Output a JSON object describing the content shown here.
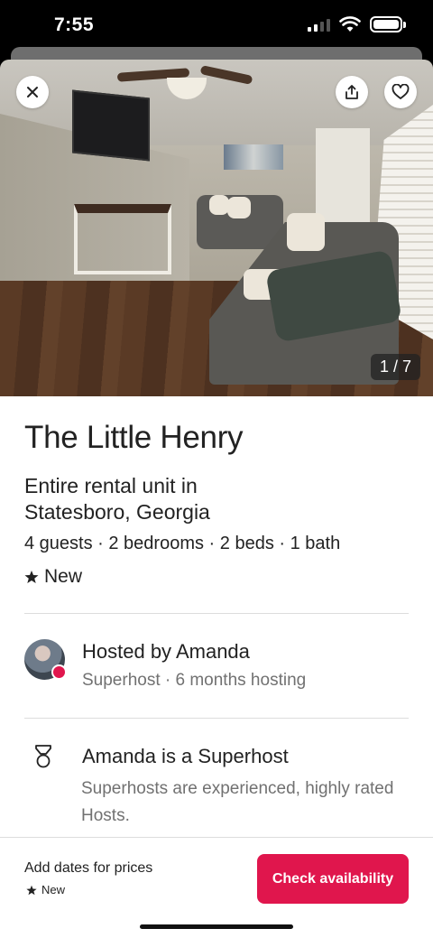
{
  "status_bar": {
    "time": "7:55"
  },
  "photo": {
    "counter": "1 / 7",
    "close_icon": "close-icon",
    "share_icon": "share-icon",
    "save_icon": "heart-icon"
  },
  "listing": {
    "title": "The Little Henry",
    "subtitle": "Entire rental unit in Statesboro, Georgia",
    "details": "4 guests · 2 bedrooms · 2 beds · 1 bath",
    "rating_label": "New"
  },
  "host": {
    "name": "Hosted by Amanda",
    "meta": "Superhost · 6 months hosting"
  },
  "superhost": {
    "title": "Amanda is a Superhost",
    "description": "Superhosts are experienced, highly rated Hosts."
  },
  "footer": {
    "price_prompt": "Add dates for prices",
    "rating_label": "New",
    "cta_label": "Check availability"
  },
  "colors": {
    "brand": "#e0164d",
    "text": "#222222",
    "muted": "#717171",
    "divider": "#dddddd"
  }
}
